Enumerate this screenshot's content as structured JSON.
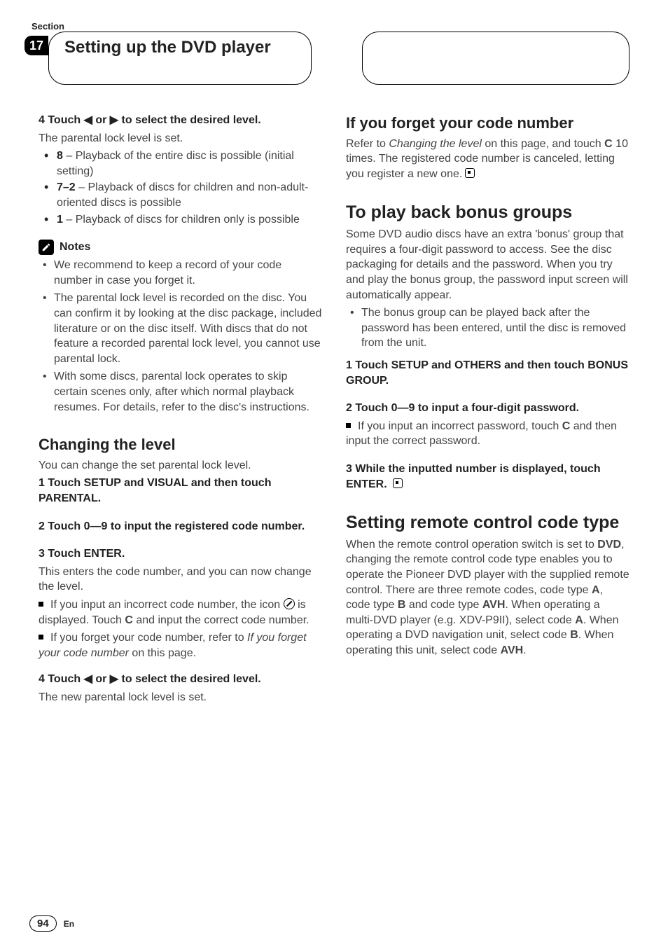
{
  "header": {
    "section_label": "Section",
    "section_number": "17",
    "title": "Setting up the DVD player"
  },
  "left": {
    "step4": {
      "line": "4   Touch ◀ or ▶ to select the desired level.",
      "desc": "The parental lock level is set.",
      "bullets": [
        {
          "b": "8",
          "rest": " – Playback of the entire disc is possible (initial setting)"
        },
        {
          "b": "7–2",
          "rest": " – Playback of discs for children and non-adult-oriented discs is possible"
        },
        {
          "b": "1",
          "rest": " – Playback of discs for children only is possible"
        }
      ]
    },
    "notes": {
      "title": "Notes",
      "items": [
        "We recommend to keep a record of your code number in case you forget it.",
        "The parental lock level is recorded on the disc. You can confirm it by looking at the disc package, included literature or on the disc itself. With discs that do not feature a recorded parental lock level, you cannot use parental lock.",
        "With some discs, parental lock operates to skip certain scenes only, after which normal playback resumes. For details, refer to the disc's instructions."
      ]
    },
    "changing": {
      "title": "Changing the level",
      "intro": "You can change the set parental lock level.",
      "step1": "1   Touch SETUP and VISUAL and then touch PARENTAL.",
      "step2": "2   Touch 0—9 to input the registered code number.",
      "step3": {
        "line": "3   Touch ENTER.",
        "desc": "This enters the code number, and you can now change the level.",
        "sub1a": "If you input an incorrect code number, the icon ",
        "sub1b": " is displayed. Touch ",
        "sub1c": "C",
        "sub1d": " and input the correct code number.",
        "sub2a": "If you forget your code number, refer to ",
        "sub2b": "If you forget your code number",
        "sub2c": " on this page."
      },
      "step4": {
        "line": "4   Touch ◀ or ▶ to select the desired level.",
        "desc": "The new parental lock level is set."
      }
    }
  },
  "right": {
    "forget": {
      "title": "If you forget your code number",
      "p1a": "Refer to ",
      "p1b": "Changing the level",
      "p1c": " on this page, and touch ",
      "p1d": "C",
      "p1e": " 10 times. The registered code number is canceled, letting you register a new one."
    },
    "bonus": {
      "title": "To play back bonus groups",
      "intro": "Some DVD audio discs have an extra 'bonus' group that requires a four-digit password to access. See the disc packaging for details and the password. When you try and play the bonus group, the password input screen will automatically appear.",
      "bullet": "The bonus group can be played back after the password has been entered, until the disc is removed from the unit.",
      "step1": "1   Touch SETUP and OTHERS and then touch BONUS GROUP.",
      "step2": {
        "line": "2   Touch 0—9 to input a four-digit password.",
        "sub_a": "If you input an incorrect password, touch ",
        "sub_b": "C",
        "sub_c": " and then input the correct password."
      },
      "step3": "3   While the inputted number is displayed, touch ENTER."
    },
    "remote": {
      "title": "Setting remote control code type",
      "p_a": "When the remote control operation switch is set to ",
      "p_b": "DVD",
      "p_c": ", changing the remote control code type enables you to operate the Pioneer DVD player with the supplied remote control. There are three remote codes, code type ",
      "p_d": "A",
      "p_e": ", code type ",
      "p_f": "B",
      "p_g": " and code type ",
      "p_h": "AVH",
      "p_i": ". When operating a multi-DVD player (e.g. XDV-P9II), select code ",
      "p_j": "A",
      "p_k": ". When operating a DVD navigation unit, select code ",
      "p_l": "B",
      "p_m": ". When operating this unit, select code ",
      "p_n": "AVH",
      "p_o": "."
    }
  },
  "footer": {
    "page": "94",
    "lang": "En"
  }
}
